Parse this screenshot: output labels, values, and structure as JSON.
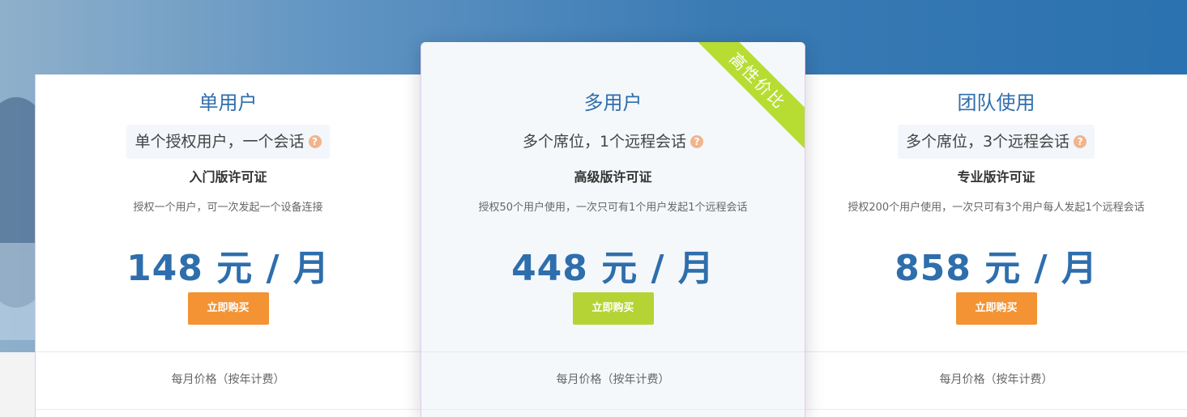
{
  "plans": [
    {
      "title": "单用户",
      "subtitle": "单个授权用户，一个会话",
      "help_icon": "?",
      "license": "入门版许可证",
      "description": "授权一个用户，可一次发起一个设备连接",
      "price": "148 元 / 月",
      "buy_label": "立即购买",
      "note": "每月价格（按年计费）"
    },
    {
      "title": "多用户",
      "subtitle": "多个席位，1个远程会话",
      "help_icon": "?",
      "license": "高级版许可证",
      "description": "授权50个用户使用，一次只可有1个用户发起1个远程会话",
      "price": "448 元 / 月",
      "buy_label": "立即购买",
      "note": "每月价格（按年计费）",
      "ribbon": "高性价比"
    },
    {
      "title": "团队使用",
      "subtitle": "多个席位，3个远程会话",
      "help_icon": "?",
      "license": "专业版许可证",
      "description": "授权200个用户使用，一次只可有3个用户每人发起1个远程会话",
      "price": "858 元 / 月",
      "buy_label": "立即购买",
      "note": "每月价格（按年计费）"
    }
  ],
  "colors": {
    "title_blue": "#2f6eac",
    "buy_orange": "#f39333",
    "buy_green": "#b5d334",
    "ribbon_green": "#b7dd32",
    "help_orange": "#f2b48a"
  }
}
